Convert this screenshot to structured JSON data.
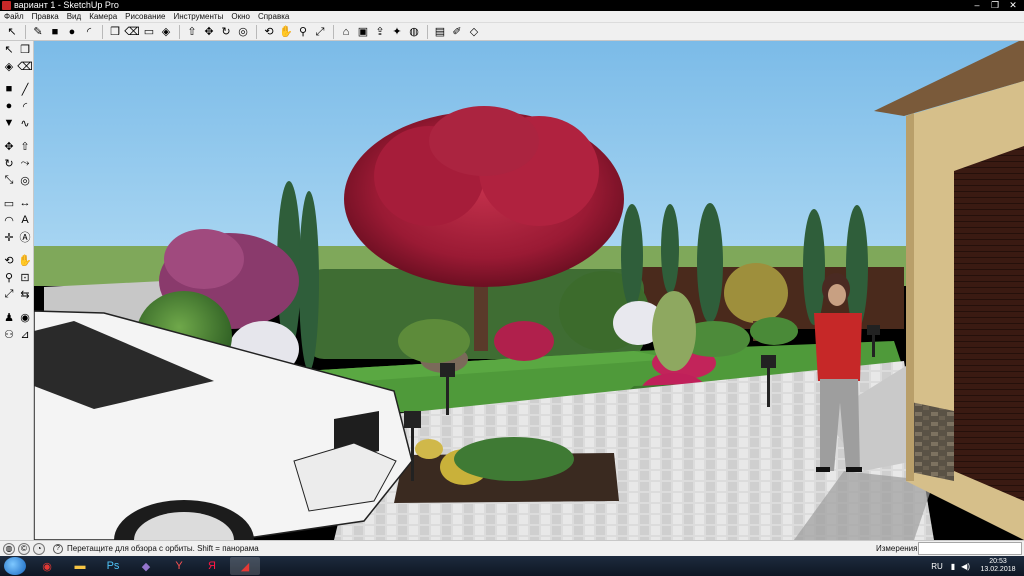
{
  "window": {
    "title": "вариант 1 - SketchUp Pro",
    "controls": [
      "–",
      "❐",
      "✕"
    ]
  },
  "menu": [
    "Файл",
    "Правка",
    "Вид",
    "Камера",
    "Рисование",
    "Инструменты",
    "Окно",
    "Справка"
  ],
  "toolbar": {
    "groups": [
      [
        {
          "name": "select-icon",
          "glyph": "↖"
        }
      ],
      [
        {
          "name": "pencil-icon",
          "glyph": "✎"
        },
        {
          "name": "rectangle-icon",
          "glyph": "■"
        },
        {
          "name": "circle-icon",
          "glyph": "●"
        },
        {
          "name": "arc-icon",
          "glyph": "◜"
        }
      ],
      [
        {
          "name": "make-component-icon",
          "glyph": "❒"
        },
        {
          "name": "eraser-icon",
          "glyph": "⌫"
        },
        {
          "name": "tape-measure-icon",
          "glyph": "▭"
        },
        {
          "name": "paint-bucket-icon",
          "glyph": "◈"
        }
      ],
      [
        {
          "name": "push-pull-icon",
          "glyph": "⇧"
        },
        {
          "name": "move-icon",
          "glyph": "✥"
        },
        {
          "name": "rotate-icon",
          "glyph": "↻"
        },
        {
          "name": "offset-icon",
          "glyph": "◎"
        }
      ],
      [
        {
          "name": "orbit-icon",
          "glyph": "⟲"
        },
        {
          "name": "pan-icon",
          "glyph": "✋"
        },
        {
          "name": "zoom-icon",
          "glyph": "⚲"
        },
        {
          "name": "zoom-extents-icon",
          "glyph": "⤢"
        }
      ],
      [
        {
          "name": "warehouse-icon",
          "glyph": "⌂"
        },
        {
          "name": "components-icon",
          "glyph": "▣"
        },
        {
          "name": "share-model-icon",
          "glyph": "⇪"
        },
        {
          "name": "extensions-icon",
          "glyph": "✦"
        },
        {
          "name": "geolocation-icon",
          "glyph": "◍"
        }
      ],
      [
        {
          "name": "layout-icon",
          "glyph": "▤"
        },
        {
          "name": "style-builder-icon",
          "glyph": "✐"
        },
        {
          "name": "sandbox-icon",
          "glyph": "◇"
        }
      ]
    ]
  },
  "palette": [
    [
      {
        "name": "select-icon",
        "glyph": "↖"
      },
      {
        "name": "make-component-icon",
        "glyph": "❒"
      }
    ],
    [
      {
        "name": "paint-bucket-icon",
        "glyph": "◈"
      },
      {
        "name": "eraser-icon",
        "glyph": "⌫"
      }
    ],
    null,
    [
      {
        "name": "rectangle-icon",
        "glyph": "■"
      },
      {
        "name": "line-icon",
        "glyph": "╱"
      }
    ],
    [
      {
        "name": "circle-icon",
        "glyph": "●"
      },
      {
        "name": "arc-icon",
        "glyph": "◜"
      }
    ],
    [
      {
        "name": "polygon-icon",
        "glyph": "▼"
      },
      {
        "name": "freehand-icon",
        "glyph": "∿"
      }
    ],
    null,
    [
      {
        "name": "move-icon",
        "glyph": "✥"
      },
      {
        "name": "push-pull-icon",
        "glyph": "⇧"
      }
    ],
    [
      {
        "name": "rotate-icon",
        "glyph": "↻"
      },
      {
        "name": "follow-me-icon",
        "glyph": "⤳"
      }
    ],
    [
      {
        "name": "scale-icon",
        "glyph": "⤡"
      },
      {
        "name": "offset-icon",
        "glyph": "◎"
      }
    ],
    null,
    [
      {
        "name": "tape-measure-icon",
        "glyph": "▭"
      },
      {
        "name": "dimension-icon",
        "glyph": "↔"
      }
    ],
    [
      {
        "name": "protractor-icon",
        "glyph": "◠"
      },
      {
        "name": "text-icon",
        "glyph": "A"
      }
    ],
    [
      {
        "name": "axes-icon",
        "glyph": "✛"
      },
      {
        "name": "3d-text-icon",
        "glyph": "Ⓐ"
      }
    ],
    null,
    [
      {
        "name": "orbit-icon",
        "glyph": "⟲"
      },
      {
        "name": "pan-icon",
        "glyph": "✋"
      }
    ],
    [
      {
        "name": "zoom-icon",
        "glyph": "⚲"
      },
      {
        "name": "zoom-window-icon",
        "glyph": "⊡"
      }
    ],
    [
      {
        "name": "zoom-extents-icon",
        "glyph": "⤢"
      },
      {
        "name": "previous-view-icon",
        "glyph": "⇆"
      }
    ],
    null,
    [
      {
        "name": "position-camera-icon",
        "glyph": "♟"
      },
      {
        "name": "look-around-icon",
        "glyph": "◉"
      }
    ],
    [
      {
        "name": "walk-icon",
        "glyph": "⚇"
      },
      {
        "name": "section-plane-icon",
        "glyph": "⊿"
      }
    ]
  ],
  "status": {
    "hint": "Перетащите для обзора с орбиты.  Shift = панорама",
    "measure_label": "Измерения",
    "measure_value": ""
  },
  "taskbar": {
    "apps": [
      {
        "name": "chrome-taskbar-icon",
        "glyph": "◉",
        "color": "#e53935"
      },
      {
        "name": "explorer-taskbar-icon",
        "glyph": "▬",
        "color": "#f6c544"
      },
      {
        "name": "photoshop-taskbar-icon",
        "glyph": "Ps",
        "color": "#4fc3f7"
      },
      {
        "name": "visual-studio-taskbar-icon",
        "glyph": "◆",
        "color": "#9575cd"
      },
      {
        "name": "yandex-browser-taskbar-icon",
        "glyph": "Y",
        "color": "#ff5252"
      },
      {
        "name": "yandex-taskbar-icon",
        "glyph": "Я",
        "color": "#ff1744"
      },
      {
        "name": "sketchup-taskbar-icon",
        "glyph": "◢",
        "color": "#e53935"
      }
    ],
    "language": "RU",
    "time": "20:53",
    "date": "13.02.2018"
  },
  "colors": {
    "sky": "#89c4ea",
    "lawn": "#4f9a3a",
    "maple": "#9c1c36",
    "paving": "#d9d9d9",
    "garage_wall": "#d6bf8a"
  }
}
